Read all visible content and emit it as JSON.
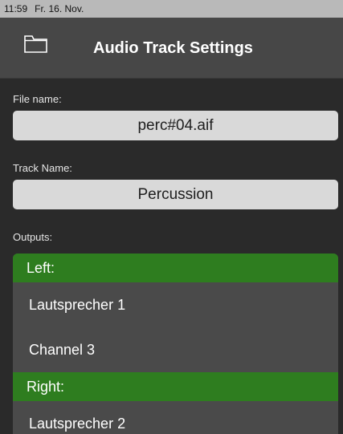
{
  "status_bar": {
    "time": "11:59",
    "date": "Fr. 16. Nov."
  },
  "nav": {
    "title": "Audio Track Settings",
    "folder_icon": "folder-icon"
  },
  "file_name": {
    "label": "File name:",
    "value": "perc#04.aif"
  },
  "track_name": {
    "label": "Track Name:",
    "value": "Percussion"
  },
  "outputs": {
    "label": "Outputs:",
    "groups": [
      {
        "header": "Left:",
        "items": [
          "Lautsprecher 1",
          "Channel 3"
        ]
      },
      {
        "header": "Right:",
        "items": [
          "Lautsprecher 2"
        ]
      }
    ]
  },
  "colors": {
    "group_header": "#2e7d1f",
    "nav_bar": "#474747",
    "field_bg": "#d9d9d9"
  }
}
